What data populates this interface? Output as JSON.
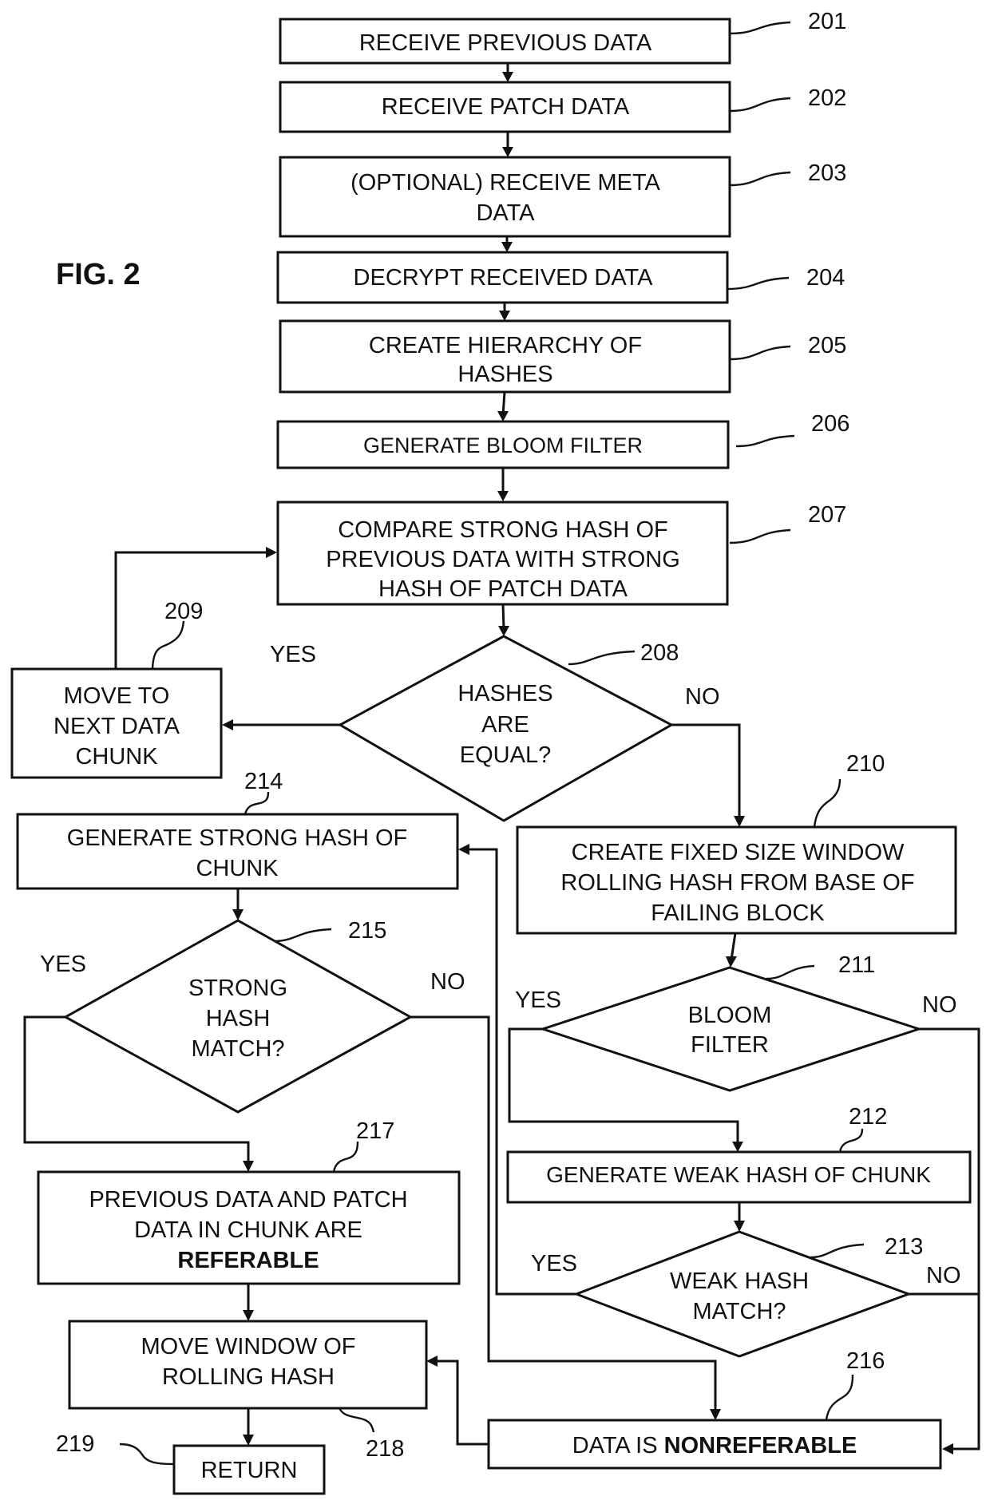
{
  "figure": {
    "label": "FIG. 2",
    "accent_color": "#111111",
    "background_color": "#ffffff"
  },
  "steps": {
    "s201": {
      "ref": "201",
      "lines": [
        "RECEIVE PREVIOUS DATA"
      ]
    },
    "s202": {
      "ref": "202",
      "lines": [
        "RECEIVE PATCH DATA"
      ]
    },
    "s203": {
      "ref": "203",
      "lines": [
        "(OPTIONAL) RECEIVE META",
        "DATA"
      ]
    },
    "s204": {
      "ref": "204",
      "lines": [
        "DECRYPT RECEIVED DATA"
      ]
    },
    "s205": {
      "ref": "205",
      "lines": [
        "CREATE HIERARCHY OF",
        "HASHES"
      ]
    },
    "s206": {
      "ref": "206",
      "lines": [
        "GENERATE BLOOM FILTER"
      ]
    },
    "s207": {
      "ref": "207",
      "lines": [
        "COMPARE STRONG HASH OF",
        "PREVIOUS DATA WITH STRONG",
        "HASH OF PATCH DATA"
      ]
    },
    "s208": {
      "ref": "208",
      "lines": [
        "HASHES",
        "ARE",
        "EQUAL?"
      ],
      "yes": "YES",
      "no": "NO"
    },
    "s209": {
      "ref": "209",
      "lines": [
        "MOVE TO",
        "NEXT DATA",
        "CHUNK"
      ]
    },
    "s210": {
      "ref": "210",
      "lines": [
        "CREATE FIXED SIZE WINDOW",
        "ROLLING HASH FROM BASE OF",
        "FAILING BLOCK"
      ]
    },
    "s211": {
      "ref": "211",
      "lines": [
        "BLOOM",
        "FILTER"
      ],
      "yes": "YES",
      "no": "NO"
    },
    "s212": {
      "ref": "212",
      "lines": [
        "GENERATE WEAK HASH OF CHUNK"
      ]
    },
    "s213": {
      "ref": "213",
      "lines": [
        "WEAK HASH",
        "MATCH?"
      ],
      "yes": "YES",
      "no": "NO"
    },
    "s214": {
      "ref": "214",
      "lines": [
        "GENERATE STRONG HASH OF",
        "CHUNK"
      ]
    },
    "s215": {
      "ref": "215",
      "lines": [
        "STRONG",
        "HASH",
        "MATCH?"
      ],
      "yes": "YES",
      "no": "NO"
    },
    "s216": {
      "ref": "216",
      "prefix": "DATA IS ",
      "emphasis": "NONREFERABLE"
    },
    "s217": {
      "ref": "217",
      "lines": [
        "PREVIOUS DATA AND PATCH",
        "DATA IN CHUNK ARE"
      ],
      "emphasis": "REFERABLE"
    },
    "s218": {
      "ref": "218",
      "lines": [
        "MOVE WINDOW OF",
        "ROLLING HASH"
      ]
    },
    "s219": {
      "ref": "219",
      "lines": [
        "RETURN"
      ]
    }
  }
}
